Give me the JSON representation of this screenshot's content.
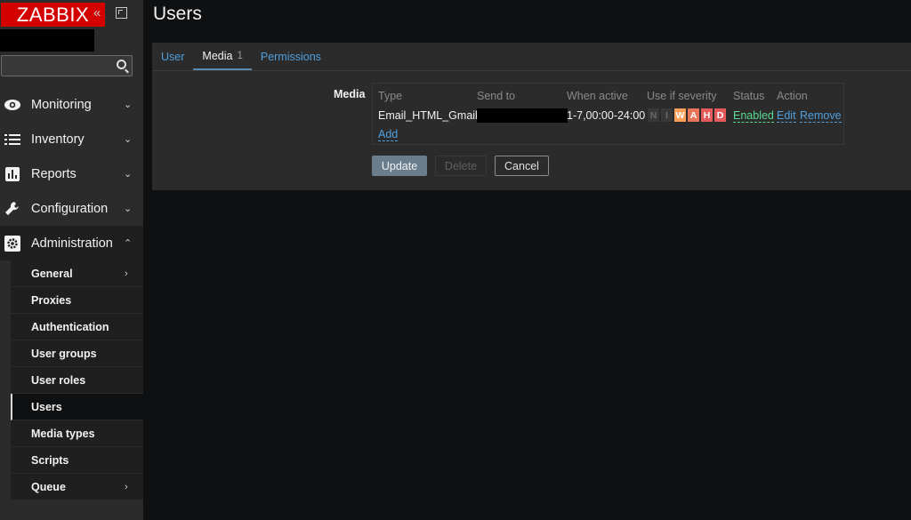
{
  "brand": {
    "logo_text": "ZABBIX",
    "color": "#d40000"
  },
  "sidebar": {
    "collapse_glyph": "«",
    "menu": [
      {
        "label": "Monitoring",
        "icon": "eye-icon",
        "chevron": "⌄"
      },
      {
        "label": "Inventory",
        "icon": "list-icon",
        "chevron": "⌄"
      },
      {
        "label": "Reports",
        "icon": "bar-chart-icon",
        "chevron": "⌄"
      },
      {
        "label": "Configuration",
        "icon": "wrench-icon",
        "chevron": "⌄"
      },
      {
        "label": "Administration",
        "icon": "gear-icon",
        "chevron": "⌃"
      }
    ],
    "submenu": [
      {
        "label": "General",
        "chevron": "›"
      },
      {
        "label": "Proxies"
      },
      {
        "label": "Authentication"
      },
      {
        "label": "User groups"
      },
      {
        "label": "User roles"
      },
      {
        "label": "Users",
        "active": true
      },
      {
        "label": "Media types"
      },
      {
        "label": "Scripts"
      },
      {
        "label": "Queue",
        "chevron": "›"
      }
    ]
  },
  "page": {
    "title": "Users"
  },
  "tabs": [
    {
      "label": "User"
    },
    {
      "label": "Media",
      "count": "1",
      "active": true
    },
    {
      "label": "Permissions"
    }
  ],
  "media": {
    "field_label": "Media",
    "columns": [
      "Type",
      "Send to",
      "When active",
      "Use if severity",
      "Status",
      "Action"
    ],
    "rows": [
      {
        "type": "Email_HTML_Gmail",
        "when_active": "1-7,00:00-24:00",
        "severity": [
          "N",
          "I",
          "W",
          "A",
          "H",
          "D"
        ],
        "status": "Enabled",
        "actions": [
          "Edit",
          "Remove"
        ]
      }
    ],
    "add_label": "Add"
  },
  "buttons": {
    "update": "Update",
    "delete": "Delete",
    "cancel": "Cancel"
  },
  "colors": {
    "link": "#4f9fde",
    "enabled": "#59db8f",
    "panel": "#2b2b2b",
    "background": "#0e1012"
  }
}
